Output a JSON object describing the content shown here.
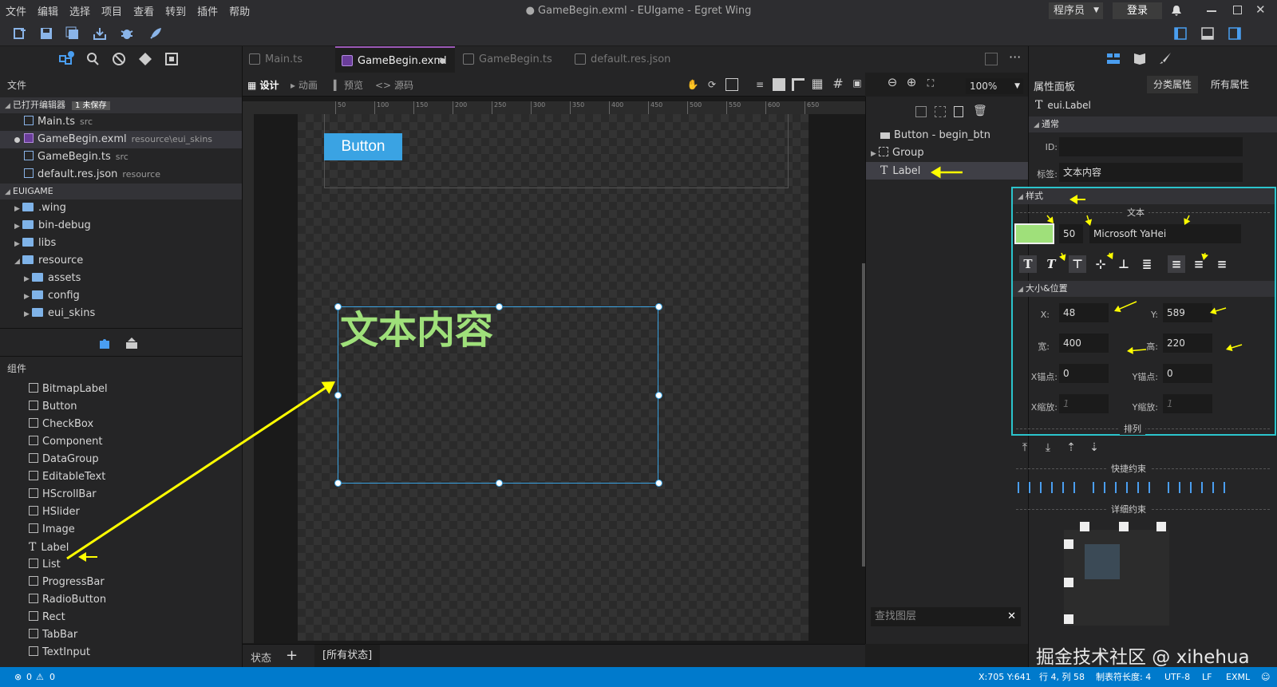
{
  "menu": [
    "文件",
    "编辑",
    "选择",
    "项目",
    "查看",
    "转到",
    "插件",
    "帮助"
  ],
  "window_title": "● GameBegin.exml - EUIgame - Egret Wing",
  "top_right": {
    "role": "程序员",
    "login": "登录"
  },
  "left": {
    "files_header": "文件",
    "open_editors": "已打开编辑器",
    "unsaved": "1 未保存",
    "open_files": [
      {
        "name": "Main.ts",
        "path": "src"
      },
      {
        "name": "GameBegin.exml",
        "path": "resource\\eui_skins"
      },
      {
        "name": "GameBegin.ts",
        "path": "src"
      },
      {
        "name": "default.res.json",
        "path": "resource"
      }
    ],
    "project": "EUIGAME",
    "tree": [
      ".wing",
      "bin-debug",
      "libs",
      "resource",
      "assets",
      "config",
      "eui_skins"
    ],
    "components_header": "组件",
    "components": [
      "BitmapLabel",
      "Button",
      "CheckBox",
      "Component",
      "DataGroup",
      "EditableText",
      "HScrollBar",
      "HSlider",
      "Image",
      "Label",
      "List",
      "ProgressBar",
      "RadioButton",
      "Rect",
      "TabBar",
      "TextInput"
    ]
  },
  "tabs": [
    "Main.ts",
    "GameBegin.exml",
    "GameBegin.ts",
    "default.res.json"
  ],
  "subtoolbar": {
    "design": "设计",
    "anim": "动画",
    "preview": "预览",
    "source": "源码",
    "zoom": "100%"
  },
  "ruler": [
    "50",
    "100",
    "150",
    "200",
    "250",
    "300",
    "350",
    "400",
    "450",
    "500",
    "550",
    "600",
    "650"
  ],
  "canvas": {
    "button_label": "Button",
    "label_text": "文本内容"
  },
  "layers": {
    "items": [
      "Button - begin_btn",
      "Group",
      "Label"
    ],
    "search_placeholder": "查找图层"
  },
  "states": {
    "label": "状态",
    "all": "[所有状态]"
  },
  "props": {
    "title": "属性面板",
    "cat": "分类属性",
    "all": "所有属性",
    "component": "eui.Label",
    "general": "通常",
    "id_label": "ID:",
    "tag_label": "标签:",
    "tag_value": "文本内容",
    "style": "样式",
    "text_group": "文本",
    "font_size": "50",
    "font": "Microsoft YaHei",
    "text_color": "#9fe07a",
    "size_pos": "大小&位置",
    "x_label": "X:",
    "x": "48",
    "y_label": "Y:",
    "y": "589",
    "w_label": "宽:",
    "w": "400",
    "h_label": "高:",
    "h": "220",
    "ax_label": "X锚点:",
    "ax": "0",
    "ay_label": "Y锚点:",
    "ay": "0",
    "sx_label": "X缩放:",
    "sx": "1",
    "sy_label": "Y缩放:",
    "sy": "1",
    "arrange": "排列",
    "quick": "快捷约束",
    "detail": "详细约束"
  },
  "watermark": "掘金技术社区 @ xihehua",
  "status": {
    "errors": "0",
    "warnings": "0",
    "cursor": "X:705 Y:641",
    "pos": "行 4, 列 58",
    "tab": "制表符长度: 4",
    "enc": "UTF-8",
    "eol": "LF",
    "lang": "EXML"
  }
}
